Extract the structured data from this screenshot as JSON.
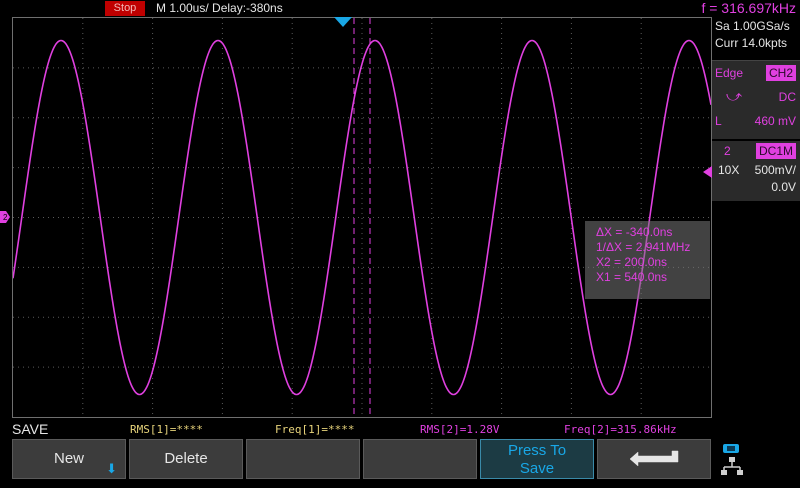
{
  "top": {
    "status": "Stop",
    "timebase": "M 1.00us/  Delay:-380ns",
    "frequency": "f = 316.697kHz"
  },
  "right_panel": {
    "sample_rate": "Sa 1.00GSa/s",
    "memory": "Curr 14.0kpts",
    "trigger": {
      "type": "Edge",
      "source": "CH2",
      "coupling": "DC",
      "level_label": "L",
      "level": "460 mV"
    },
    "channel": {
      "number": "2",
      "coupling": "DC1M",
      "probe": "10X",
      "scale": "500mV/",
      "offset": "0.0V"
    }
  },
  "cursors": {
    "dx": "ΔX = -340.0ns",
    "inv_dx": "1/ΔX = 2.941MHz",
    "x2": "X2 = 200.0ns",
    "x1": "X1 = 540.0ns"
  },
  "status": {
    "menu_label": "SAVE",
    "rms1": "RMS[1]=****",
    "freq1": "Freq[1]=****",
    "rms2": "RMS[2]=1.28V",
    "freq2": "Freq[2]=315.86kHz"
  },
  "softkeys": {
    "new": "New",
    "delete": "Delete",
    "press_to_save_line1": "Press To",
    "press_to_save_line2": "Save",
    "back_icon": "return-arrow-icon",
    "usb_icon": "usb-network-icon"
  },
  "colors": {
    "ch2": "#e040e0",
    "accent": "#19a7e6",
    "stop": "#c00000"
  },
  "waveform": {
    "channel": "CH2",
    "frequency_khz": 315.86,
    "shape": "sine"
  }
}
